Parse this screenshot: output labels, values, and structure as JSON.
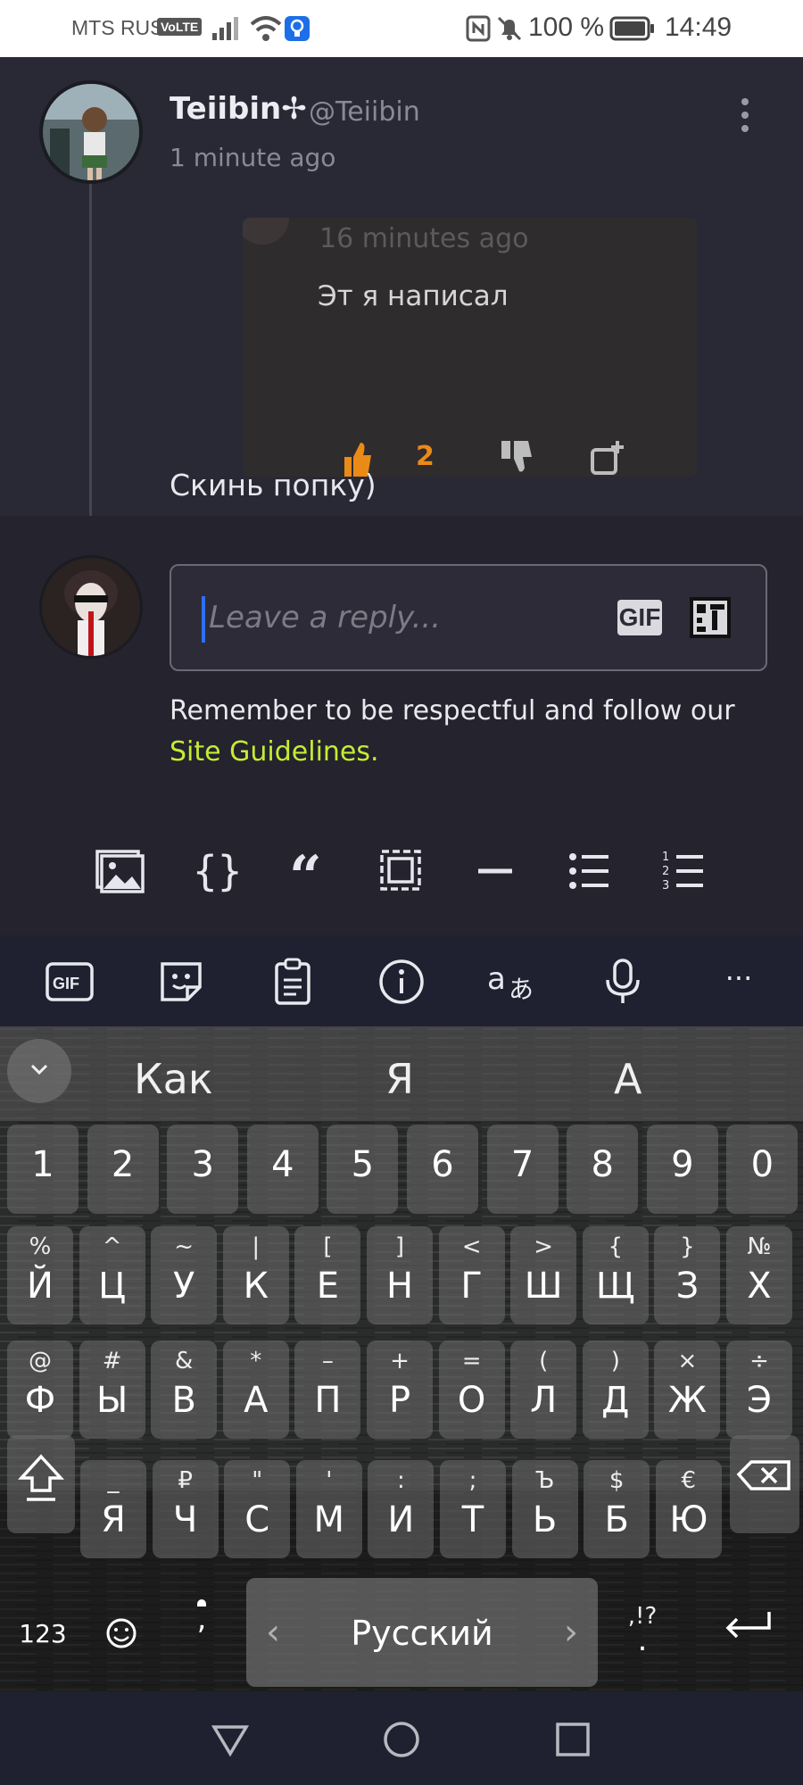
{
  "status_bar": {
    "carrier": "MTS RUS",
    "volte": "VoLTE",
    "battery": "100 %",
    "time": "14:49"
  },
  "comment": {
    "username": "Teiibin✢",
    "handle": "@Teiibin",
    "timestamp": "1 minute ago",
    "embedded_screenshot": {
      "timestamp": "16 minutes ago",
      "text": "Эт я написал",
      "like_count": "2"
    },
    "text": "Скинь попку)"
  },
  "reply": {
    "placeholder": "Leave a reply...",
    "gif_label": "GIF",
    "guidelines_text": "Remember to be respectful and follow our ",
    "guidelines_link": "Site Guidelines",
    "guidelines_end": "."
  },
  "format_toolbar": {
    "icons": [
      "image-icon",
      "code-braces-icon",
      "quote-icon",
      "spoiler-icon",
      "divider-icon",
      "bulleted-list-icon",
      "numbered-list-icon"
    ]
  },
  "keyboard_tools": {
    "gif_label": "GIF",
    "more_label": "···",
    "icons": [
      "gif-icon",
      "sticker-icon",
      "clipboard-icon",
      "info-icon",
      "translate-icon",
      "microphone-icon",
      "more-icon"
    ]
  },
  "keyboard": {
    "suggestions": [
      "Как",
      "Я",
      "А"
    ],
    "number_row": [
      "1",
      "2",
      "3",
      "4",
      "5",
      "6",
      "7",
      "8",
      "9",
      "0"
    ],
    "row1": [
      {
        "main": "Й",
        "sub": "%"
      },
      {
        "main": "Ц",
        "sub": "^"
      },
      {
        "main": "У",
        "sub": "~"
      },
      {
        "main": "К",
        "sub": "|"
      },
      {
        "main": "Е",
        "sub": "["
      },
      {
        "main": "Н",
        "sub": "]"
      },
      {
        "main": "Г",
        "sub": "<"
      },
      {
        "main": "Ш",
        "sub": ">"
      },
      {
        "main": "Щ",
        "sub": "{"
      },
      {
        "main": "З",
        "sub": "}"
      },
      {
        "main": "Х",
        "sub": "№"
      }
    ],
    "row2": [
      {
        "main": "Ф",
        "sub": "@"
      },
      {
        "main": "Ы",
        "sub": "#"
      },
      {
        "main": "В",
        "sub": "&"
      },
      {
        "main": "А",
        "sub": "*"
      },
      {
        "main": "П",
        "sub": "–"
      },
      {
        "main": "Р",
        "sub": "+"
      },
      {
        "main": "О",
        "sub": "="
      },
      {
        "main": "Л",
        "sub": "("
      },
      {
        "main": "Д",
        "sub": ")"
      },
      {
        "main": "Ж",
        "sub": "×"
      },
      {
        "main": "Э",
        "sub": "÷"
      }
    ],
    "row3": [
      {
        "main": "Я",
        "sub": "_"
      },
      {
        "main": "Ч",
        "sub": "₽"
      },
      {
        "main": "С",
        "sub": "\""
      },
      {
        "main": "М",
        "sub": "'"
      },
      {
        "main": "И",
        "sub": ":"
      },
      {
        "main": "Т",
        "sub": ";"
      },
      {
        "main": "Ь",
        "sub": "Ъ"
      },
      {
        "main": "Б",
        "sub": "$"
      },
      {
        "main": "Ю",
        "sub": "€"
      }
    ],
    "numbers_key": "123",
    "comma_key": ",",
    "period_key": ".",
    "punct_hint": ",!?",
    "space_label": "Русский",
    "space_left": "‹",
    "space_right": "›"
  },
  "colors": {
    "accent_link": "#c5ec33",
    "like_orange": "#ea8a17",
    "cursor_blue": "#2f6ff2"
  }
}
